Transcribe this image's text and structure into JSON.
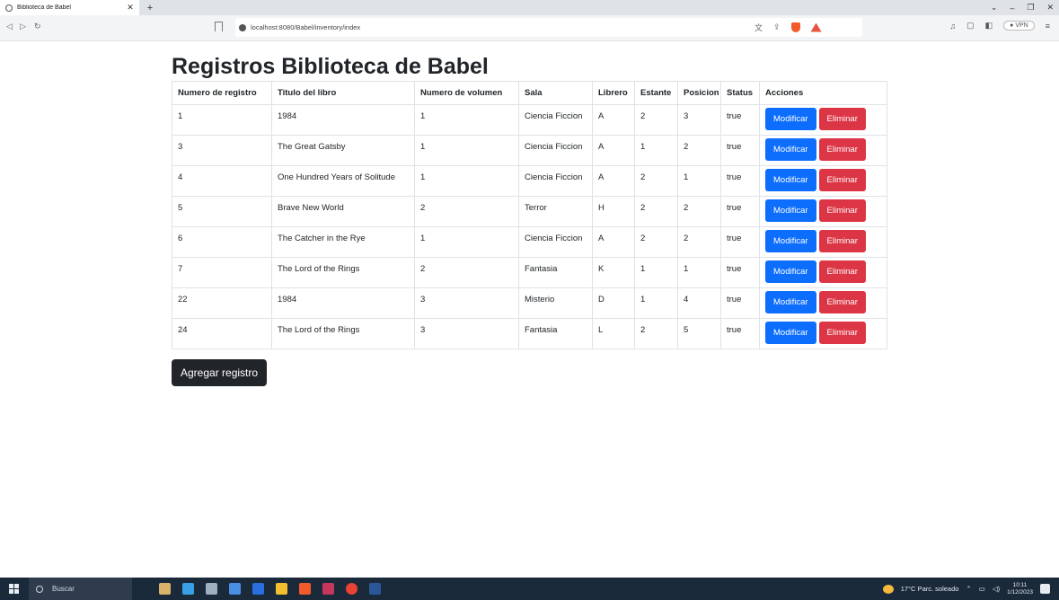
{
  "browser": {
    "tab_title": "Biblioteca de Babel",
    "url": "localhost:8080/Babel/inventory/index",
    "vpn_label": "VPN"
  },
  "page": {
    "heading": "Registros Biblioteca de Babel",
    "columns": [
      "Numero de registro",
      "Titulo del libro",
      "Numero de volumen",
      "Sala",
      "Librero",
      "Estante",
      "Posicion",
      "Status",
      "Acciones"
    ],
    "rows": [
      [
        "1",
        "1984",
        "1",
        "Ciencia Ficcion",
        "A",
        "2",
        "3",
        "true"
      ],
      [
        "3",
        "The Great Gatsby",
        "1",
        "Ciencia Ficcion",
        "A",
        "1",
        "2",
        "true"
      ],
      [
        "4",
        "One Hundred Years of Solitude",
        "1",
        "Ciencia Ficcion",
        "A",
        "2",
        "1",
        "true"
      ],
      [
        "5",
        "Brave New World",
        "2",
        "Terror",
        "H",
        "2",
        "2",
        "true"
      ],
      [
        "6",
        "The Catcher in the Rye",
        "1",
        "Ciencia Ficcion",
        "A",
        "2",
        "2",
        "true"
      ],
      [
        "7",
        "The Lord of the Rings",
        "2",
        "Fantasia",
        "K",
        "1",
        "1",
        "true"
      ],
      [
        "22",
        "1984",
        "3",
        "Misterio",
        "D",
        "1",
        "4",
        "true"
      ],
      [
        "24",
        "The Lord of the Rings",
        "3",
        "Fantasia",
        "L",
        "2",
        "5",
        "true"
      ]
    ],
    "modify_label": "Modificar",
    "delete_label": "Eliminar",
    "add_label": "Agregar registro"
  },
  "taskbar": {
    "search_placeholder": "Buscar",
    "weather": "17°C  Parc. soleado",
    "time": "10:11",
    "date": "1/12/2023"
  },
  "colors": {
    "primary": "#0d6efd",
    "danger": "#dc3545",
    "dark": "#212529"
  }
}
